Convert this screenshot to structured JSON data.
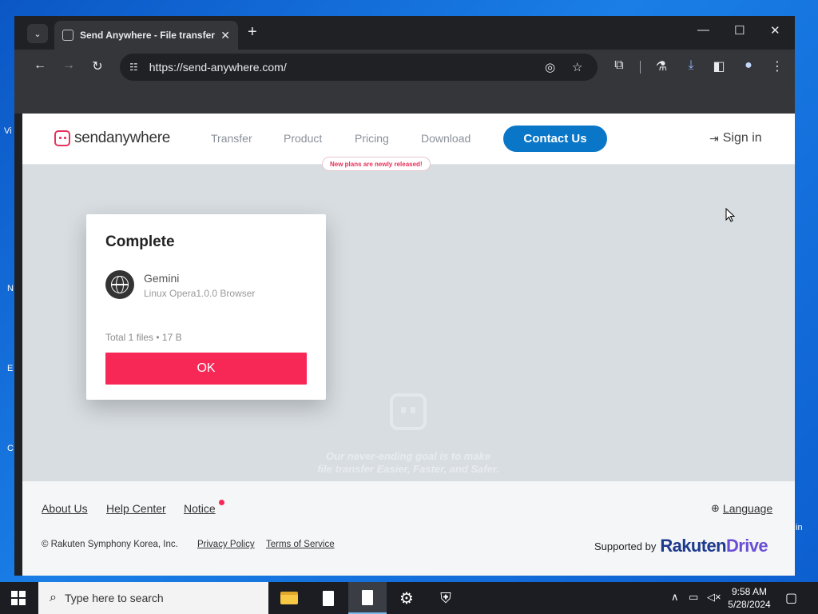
{
  "desktop": {
    "fragments": [
      "Vi",
      "N",
      "E",
      "C",
      "in"
    ]
  },
  "browser": {
    "tab": {
      "title": "Send Anywhere - File transfer",
      "close": "✕"
    },
    "tab_search_icon": "⌄",
    "new_tab": "+",
    "window_controls": {
      "minimize": "—",
      "maximize": "☐",
      "close": "✕"
    },
    "nav": {
      "back": "←",
      "forward": "→",
      "reload": "↻"
    },
    "url": "https://send-anywhere.com/",
    "icons": {
      "site_info": "☷",
      "eye_off": "◎",
      "star": "☆",
      "extensions": "⧉",
      "labs": "⚗",
      "download": "⤓",
      "sidepanel": "◧",
      "profile": "●",
      "menu": "⋮"
    }
  },
  "site": {
    "logo": {
      "prefix": "send",
      "suffix": "anywhere"
    },
    "nav": [
      "Transfer",
      "Product",
      "Pricing",
      "Download"
    ],
    "contact": "Contact Us",
    "signin": "Sign in",
    "signin_icon": "⇥",
    "pricing_badge": "New plans are newly released!",
    "slogan_line1": "Our never-ending goal is to make",
    "slogan_line2": "file transfer Easier, Faster, and Safer."
  },
  "modal": {
    "title": "Complete",
    "device_name": "Gemini",
    "device_sub": "Linux Opera1.0.0 Browser",
    "total": "Total 1 files • 17 B",
    "ok": "OK"
  },
  "footer": {
    "links": [
      "About Us",
      "Help Center",
      "Notice"
    ],
    "language": "Language",
    "language_icon": "⊕",
    "copyright": "© Rakuten Symphony Korea, Inc.",
    "privacy": "Privacy Policy",
    "terms": "Terms of Service",
    "supported_by": "Supported by",
    "rakuten_logo": {
      "first": "Rakuten",
      "second": "Drive"
    }
  },
  "taskbar": {
    "search_placeholder": "Type here to search",
    "search_icon": "⌕",
    "gear_icon": "⚙",
    "shield_icon": "⛨",
    "tray": {
      "chevron": "∧",
      "network": "▭",
      "volume": "◁×"
    },
    "time": "9:58 AM",
    "date": "5/28/2024",
    "notification_icon": "▢"
  },
  "colors": {
    "accent_blue": "#0a76c7",
    "ok_pink": "#f72856",
    "brand_red": "#e8315b",
    "page_bg": "#d7dde1"
  }
}
